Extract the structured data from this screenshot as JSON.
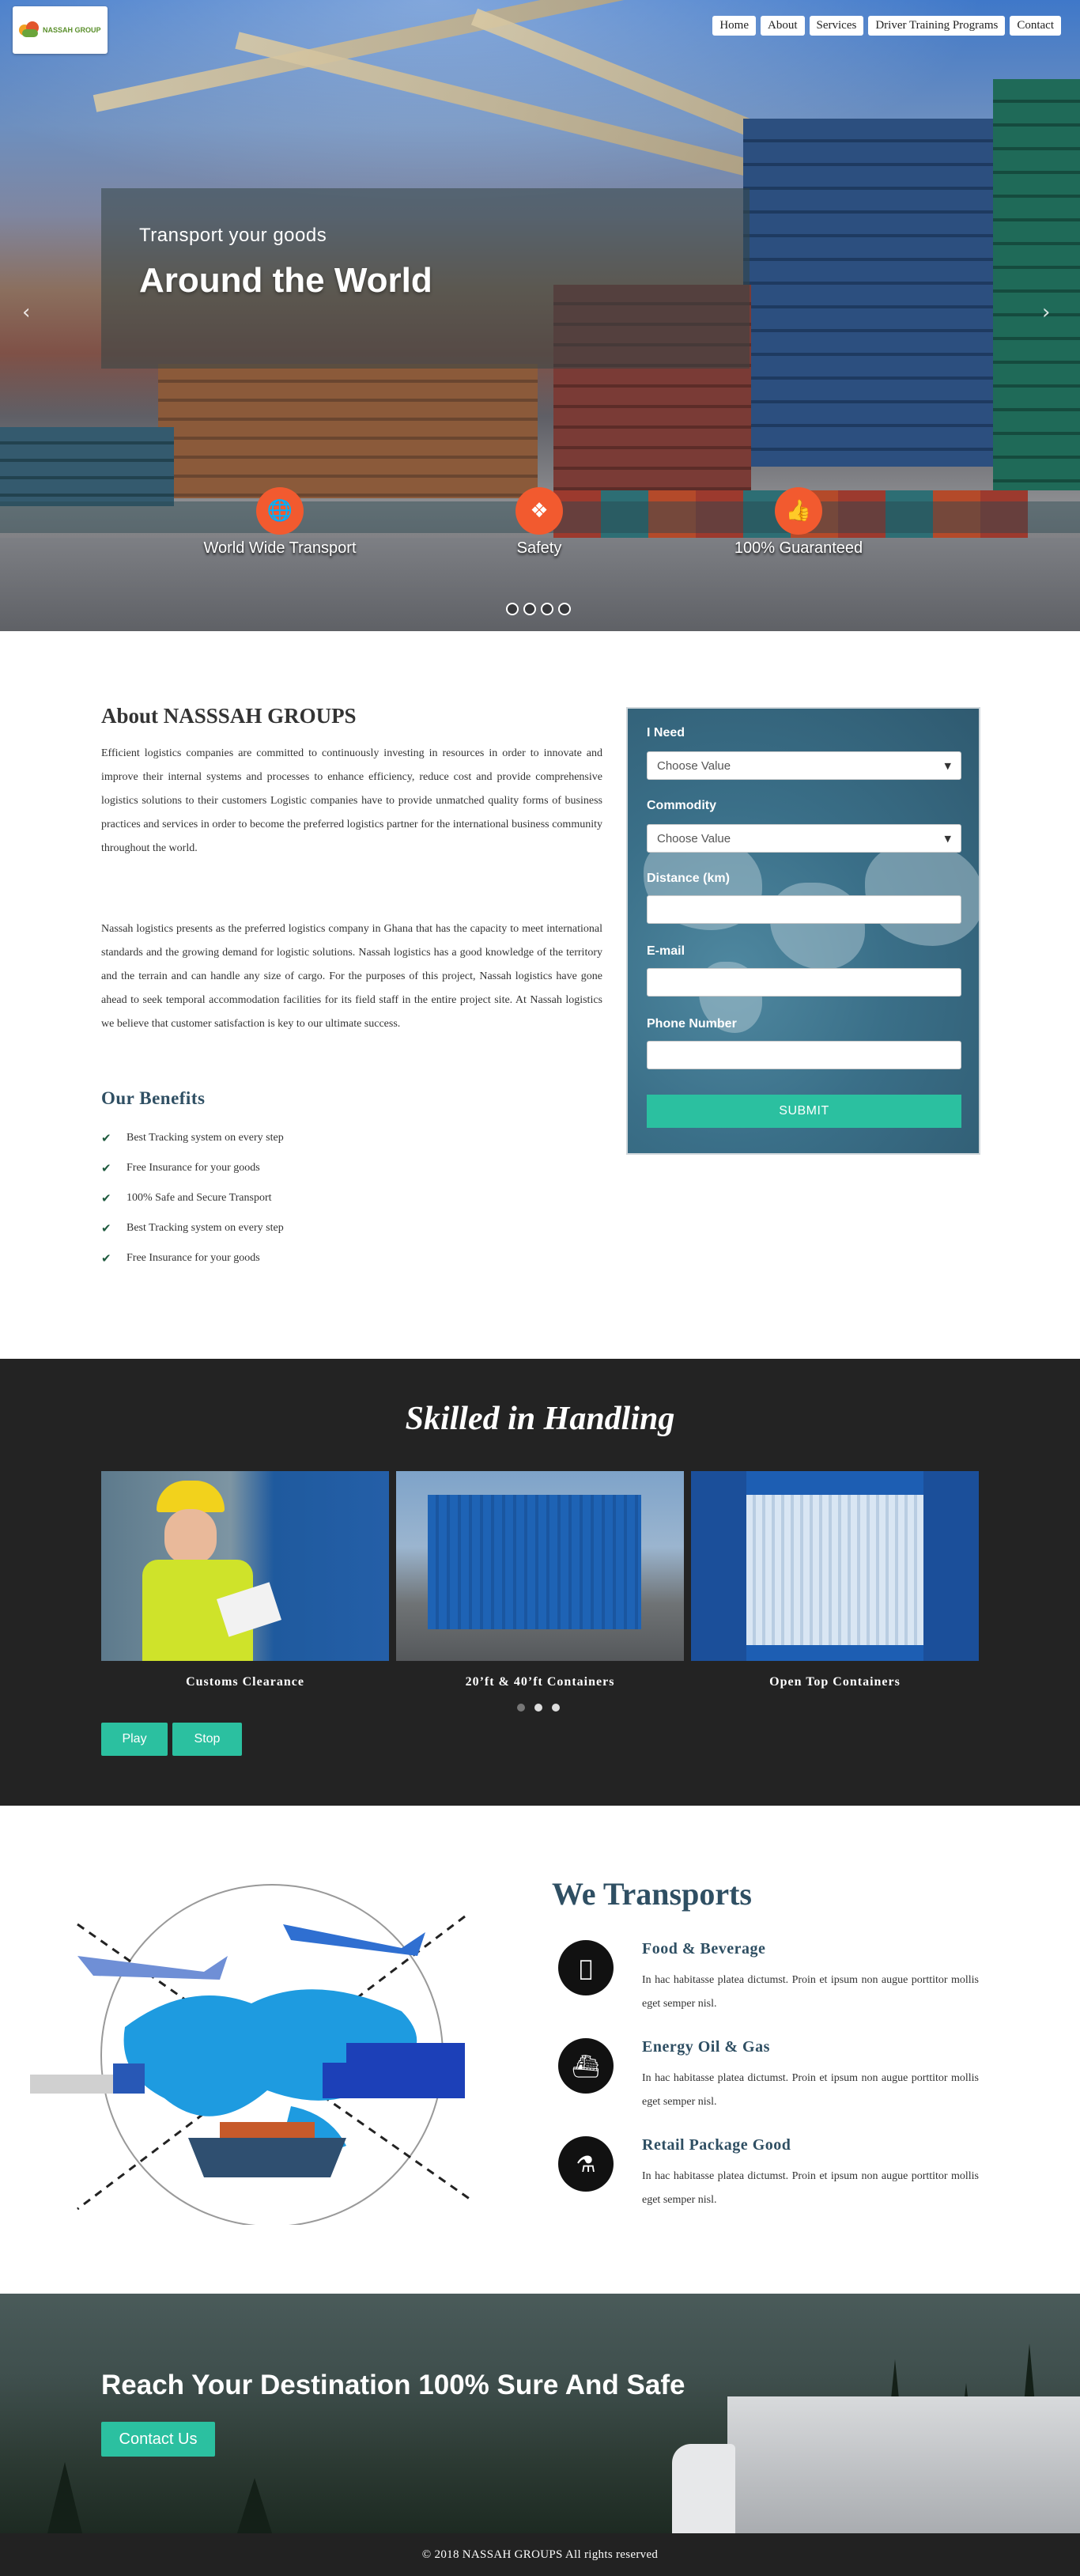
{
  "brand": {
    "logo_text": "NASSAH GROUP",
    "accent": "#2bc0a0",
    "orange": "#f25a2f",
    "heading": "#2f4f63"
  },
  "nav": {
    "items": [
      "Home",
      "About",
      "Services",
      "Driver Training Programs",
      "Contact"
    ]
  },
  "hero": {
    "subtitle": "Transport your goods",
    "title": "Around the World",
    "prev_icon": "chevron-left-icon",
    "next_icon": "chevron-right-icon",
    "features": [
      {
        "icon": "globe-icon",
        "label": "World Wide Transport"
      },
      {
        "icon": "dropbox-icon",
        "label": "Safety"
      },
      {
        "icon": "thumbs-up-icon",
        "label": "100% Guaranteed"
      }
    ],
    "slide_count": 4
  },
  "about": {
    "title": "About NASSSAH GROUPS",
    "paragraphs": [
      "Efficient logistics companies are committed to continuously investing in resources in order to innovate and improve their internal systems and processes to enhance efficiency, reduce cost and provide comprehensive logistics solutions to their customers Logistic companies have to provide unmatched quality forms of business practices and services in order to become the preferred logistics partner for the international business community throughout the world.",
      "Nassah logistics presents as the preferred logistics company in Ghana that has the capacity to meet international standards and the growing demand for logistic solutions. Nassah logistics has a good knowledge of the territory and the terrain and can handle any size of cargo. For the purposes of this project, Nassah logistics have gone ahead to seek temporal accommodation facilities for its field staff in the entire project site. At Nassah logistics we believe that customer satisfaction is key to our ultimate success."
    ],
    "benefits_title": "Our Benefits",
    "benefits": [
      "Best Tracking system on every step",
      "Free Insurance for your goods",
      "100% Safe and Secure Transport",
      "Best Tracking system on every step",
      "Free Insurance for your goods"
    ]
  },
  "form": {
    "need_label": "I Need",
    "need_value": "Choose Value",
    "commodity_label": "Commodity",
    "commodity_value": "Choose Value",
    "distance_label": "Distance (km)",
    "email_label": "E-mail",
    "phone_label": "Phone Number",
    "submit": "SUBMIT"
  },
  "skilled": {
    "title": "Skilled in Handling",
    "cards": [
      "Customs Clearance",
      "20’ft & 40’ft Containers",
      "Open Top Containers"
    ],
    "active_dot": 1,
    "play": "Play",
    "stop": "Stop"
  },
  "transports": {
    "title": "We Transports",
    "items": [
      {
        "icon": "apple-icon",
        "title": "Food & Beverage",
        "text": "In hac habitasse platea dictumst. Proin et ipsum non augue porttitor mollis eget semper nisl."
      },
      {
        "icon": "ship-icon",
        "title": "Energy Oil & Gas",
        "text": "In hac habitasse platea dictumst. Proin et ipsum non augue porttitor mollis eget semper nisl."
      },
      {
        "icon": "hand-truck-icon",
        "title": "Retail Package Good",
        "text": "In hac habitasse platea dictumst. Proin et ipsum non augue porttitor mollis eget semper nisl."
      }
    ]
  },
  "cta": {
    "title": "Reach Your Destination 100% Sure And Safe",
    "button": "Contact Us"
  },
  "footer": {
    "text": "© 2018 NASSAH GROUPS All rights reserved"
  }
}
